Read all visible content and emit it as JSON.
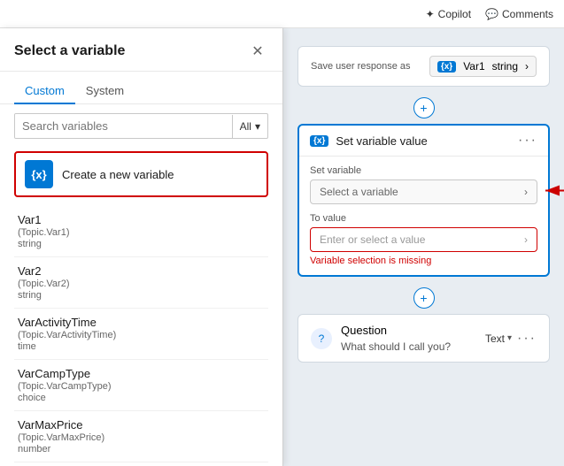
{
  "topbar": {
    "copilot_label": "Copilot",
    "comments_label": "Comments"
  },
  "panel": {
    "title": "Select a variable",
    "tabs": [
      {
        "id": "custom",
        "label": "Custom",
        "active": true
      },
      {
        "id": "system",
        "label": "System",
        "active": false
      }
    ],
    "search_placeholder": "Search variables",
    "filter_label": "All",
    "create_btn_label": "Create a new variable",
    "create_btn_icon": "{x}",
    "variables": [
      {
        "name": "Var1",
        "topic": "(Topic.Var1)",
        "type": "string"
      },
      {
        "name": "Var2",
        "topic": "(Topic.Var2)",
        "type": "string"
      },
      {
        "name": "VarActivityTime",
        "topic": "(Topic.VarActivityTime)",
        "type": "time"
      },
      {
        "name": "VarCampType",
        "topic": "(Topic.VarCampType)",
        "type": "choice"
      },
      {
        "name": "VarMaxPrice",
        "topic": "(Topic.VarMaxPrice)",
        "type": "number"
      }
    ]
  },
  "canvas": {
    "save_response_label": "Save user response as",
    "var1_badge": "{x}",
    "var1_name": "Var1",
    "var1_type": "string",
    "set_variable_title": "Set variable value",
    "set_variable_badge": "{x}",
    "set_variable_label": "Set variable",
    "select_variable_placeholder": "Select a variable",
    "to_value_label": "To value",
    "enter_value_placeholder": "Enter or select a value",
    "error_text": "Variable selection is missing",
    "question_title": "Question",
    "question_type": "Text",
    "question_sub": "What should I call you?"
  },
  "icons": {
    "close": "✕",
    "chevron_right": "›",
    "chevron_down": "⌄",
    "plus": "+",
    "dots": "···",
    "question_mark": "?"
  }
}
